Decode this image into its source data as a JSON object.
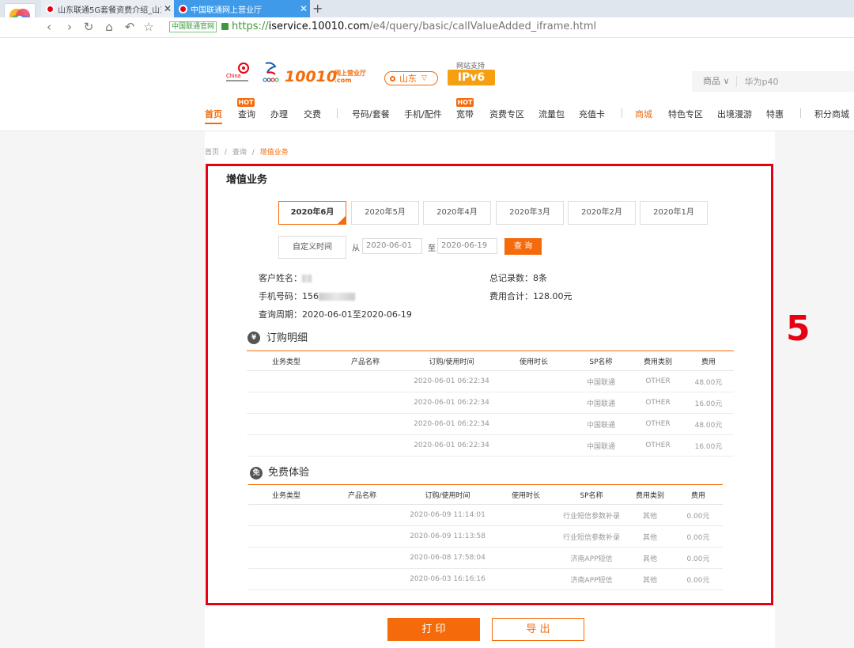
{
  "browser": {
    "tabs": [
      {
        "title": "山东联通5G套餐资费介绍_山东联"
      },
      {
        "title": "中国联通网上营业厅"
      }
    ],
    "site_badge": "中国联通官网",
    "url_https": "https://",
    "url_main": "iservice.10010.com",
    "url_rest": "/e4/query/basic/callValueAdded_iframe.html"
  },
  "header": {
    "logo_text": "10010",
    "logo_sub_1": "网上营业厅",
    "logo_sub_2": ".com",
    "region": "山东",
    "ipv6_caption": "网站支持",
    "ipv6": "IPv6",
    "search_category": "商品",
    "search_placeholder": "华为p40"
  },
  "nav": {
    "items": [
      "首页",
      "查询",
      "办理",
      "交费",
      "号码/套餐",
      "手机/配件",
      "宽带",
      "资费专区",
      "流量包",
      "充值卡",
      "商城",
      "特色专区",
      "出境漫游",
      "特惠",
      "积分商城"
    ],
    "hot": "HOT"
  },
  "breadcrumb": {
    "home": "首页",
    "sep": "/",
    "query": "查询",
    "current": "增值业务"
  },
  "page_title": "增值业务",
  "month_tabs": [
    "2020年6月",
    "2020年5月",
    "2020年4月",
    "2020年3月",
    "2020年2月",
    "2020年1月"
  ],
  "custom_range": {
    "button": "自定义时间",
    "from_label": "从",
    "from": "2020-06-01",
    "to_label": "至",
    "to": "2020-06-19",
    "query": "查 询"
  },
  "summary": {
    "name_label": "客户姓名：",
    "phone_label": "手机号码：156",
    "period": "查询周期：2020-06-01至2020-06-19",
    "total_records": "总记录数：8条",
    "total_fee": "费用合计：128.00元"
  },
  "orders": {
    "icon": "¥",
    "title": "订购明细",
    "columns": [
      "业务类型",
      "产品名称",
      "订购/使用时间",
      "使用时长",
      "SP名称",
      "费用类别",
      "费用"
    ],
    "rows": [
      [
        "",
        "",
        "2020-06-01 06:22:34",
        "",
        "中国联通",
        "OTHER",
        "48.00元"
      ],
      [
        "",
        "",
        "2020-06-01 06:22:34",
        "",
        "中国联通",
        "OTHER",
        "16.00元"
      ],
      [
        "",
        "",
        "2020-06-01 06:22:34",
        "",
        "中国联通",
        "OTHER",
        "48.00元"
      ],
      [
        "",
        "",
        "2020-06-01 06:22:34",
        "",
        "中国联通",
        "OTHER",
        "16.00元"
      ]
    ]
  },
  "free": {
    "icon": "免",
    "title": "免费体验",
    "columns": [
      "业务类型",
      "产品名称",
      "订购/使用时间",
      "使用时长",
      "SP名称",
      "费用类别",
      "费用"
    ],
    "rows": [
      [
        "",
        "",
        "2020-06-09 11:14:01",
        "",
        "行业短信参数补录",
        "其他",
        "0.00元"
      ],
      [
        "",
        "",
        "2020-06-09 11:13:58",
        "",
        "行业短信参数补录",
        "其他",
        "0.00元"
      ],
      [
        "",
        "",
        "2020-06-08 17:58:04",
        "",
        "济南APP短信",
        "其他",
        "0.00元"
      ],
      [
        "",
        "",
        "2020-06-03 16:16:16",
        "",
        "济南APP短信",
        "其他",
        "0.00元"
      ]
    ]
  },
  "actions": {
    "print": "打 印",
    "export": "导 出"
  },
  "annotation": {
    "number": "5"
  },
  "colors": {
    "accent": "#f56b0b",
    "annotation": "#e60012"
  }
}
